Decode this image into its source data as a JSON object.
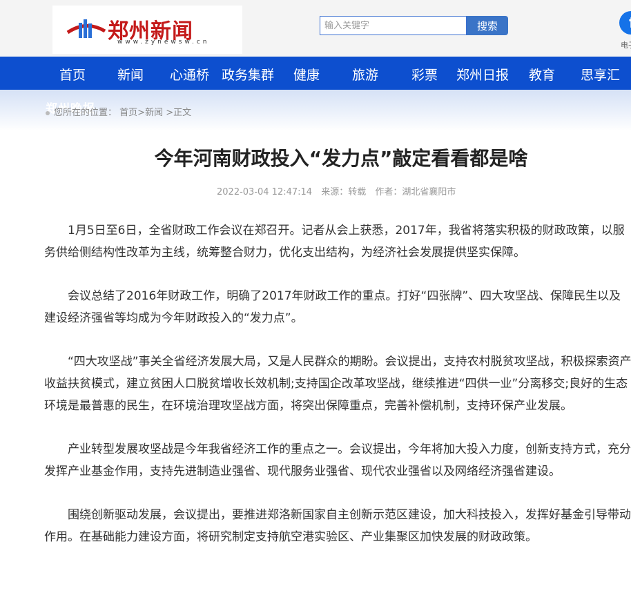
{
  "header": {
    "logo_text": "郑州新闻",
    "logo_url": "www.zynewsw.cn",
    "search_placeholder": "输入关键字",
    "search_button": "搜索",
    "fb_label": "电子版"
  },
  "nav": {
    "items": [
      "首页",
      "新闻",
      "心通桥",
      "政务集群",
      "健康",
      "旅游",
      "彩票",
      "郑州日报",
      "教育",
      "思享汇"
    ]
  },
  "ghost_text": "郑州晚报",
  "breadcrumb": {
    "prefix": "您所在的位置：",
    "home": "首页",
    "sep1": ">",
    "news": "新闻",
    "sep2": " >",
    "current": "正文"
  },
  "article": {
    "title": "今年河南财政投入“发力点”敲定看看都是啥",
    "date": "2022-03-04 12:47:14",
    "source": "来源：转载",
    "author": "作者：湖北省襄阳市",
    "paragraphs": [
      "1月5日至6日，全省财政工作会议在郑召开。记者从会上获悉，2017年，我省将落实积极的财政政策，以服务供给侧结构性改革为主线，统筹整合财力，优化支出结构，为经济社会发展提供坚实保障。",
      "会议总结了2016年财政工作，明确了2017年财政工作的重点。打好“四张牌”、四大攻坚战、保障民生以及建设经济强省等均成为今年财政投入的“发力点”。",
      "“四大攻坚战”事关全省经济发展大局，又是人民群众的期盼。会议提出，支持农村脱贫攻坚战，积极探索资产收益扶贫模式，建立贫困人口脱贫增收长效机制;支持国企改革攻坚战，继续推进“四供一业”分离移交;良好的生态环境是最普惠的民生，在环境治理攻坚战方面，将突出保障重点，完善补偿机制，支持环保产业发展。",
      "产业转型发展攻坚战是今年我省经济工作的重点之一。会议提出，今年将加大投入力度，创新支持方式，充分发挥产业基金作用，支持先进制造业强省、现代服务业强省、现代农业强省以及网络经济强省建设。",
      "围绕创新驱动发展，会议提出，要推进郑洛新国家自主创新示范区建设，加大科技投入，发挥好基金引导带动作用。在基础能力建设方面，将研究制定支持航空港实验区、产业集聚区加快发展的财政政策。"
    ]
  },
  "colors": {
    "nav_bg": "#0d4fcf",
    "logo_red": "#c41a1a",
    "search_button_bg": "#3a74c7"
  },
  "icons": [
    "logo-mark-icon",
    "facebook-icon"
  ]
}
